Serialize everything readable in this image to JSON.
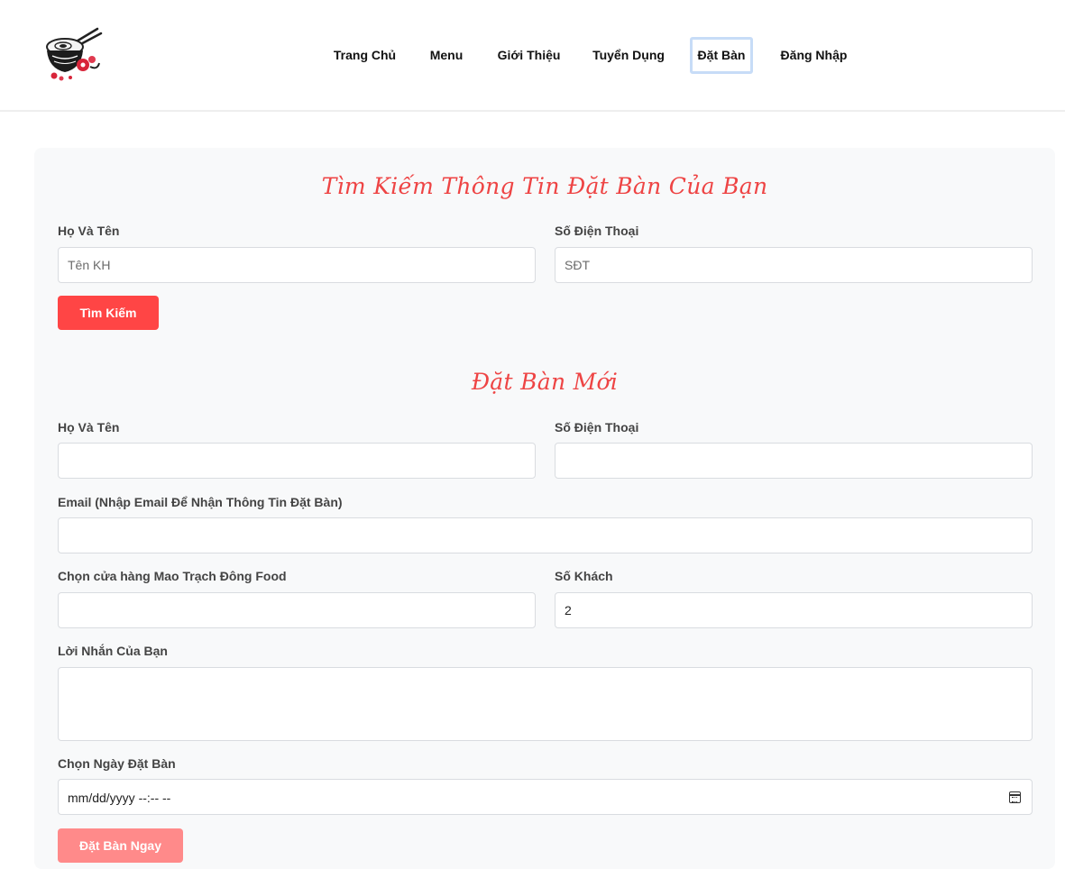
{
  "nav": {
    "items": [
      {
        "label": "Trang Chủ"
      },
      {
        "label": "Menu"
      },
      {
        "label": "Giới Thiệu"
      },
      {
        "label": "Tuyển Dụng"
      },
      {
        "label": "Đặt Bàn",
        "active": true
      },
      {
        "label": "Đăng Nhập"
      }
    ]
  },
  "search_section": {
    "title": "Tìm Kiếm Thông Tin Đặt Bàn Của Bạn",
    "name_label": "Họ Và Tên",
    "name_placeholder": "Tên KH",
    "phone_label": "Số Điện Thoại",
    "phone_placeholder": "SĐT",
    "button_label": "Tìm Kiếm"
  },
  "booking_section": {
    "title": "Đặt Bàn Mới",
    "name_label": "Họ Và Tên",
    "name_value": "",
    "phone_label": "Số Điện Thoại",
    "phone_value": "",
    "email_label": "Email (Nhập Email Để Nhận Thông Tin Đặt Bàn)",
    "email_value": "",
    "store_label": "Chọn cửa hàng Mao Trạch Đông Food",
    "store_value": "",
    "guests_label": "Số Khách",
    "guests_value": "2",
    "message_label": "Lời Nhắn Của Bạn",
    "date_label": "Chọn Ngày Đặt Bàn",
    "date_placeholder": "mm/dd/yyyy --:-- --",
    "button_label": "Đặt Bàn Ngay"
  },
  "colors": {
    "accent": "#ff4545",
    "accent_light": "#ff8a8a",
    "title": "#ee4444",
    "card_bg": "#f8f9fa"
  }
}
